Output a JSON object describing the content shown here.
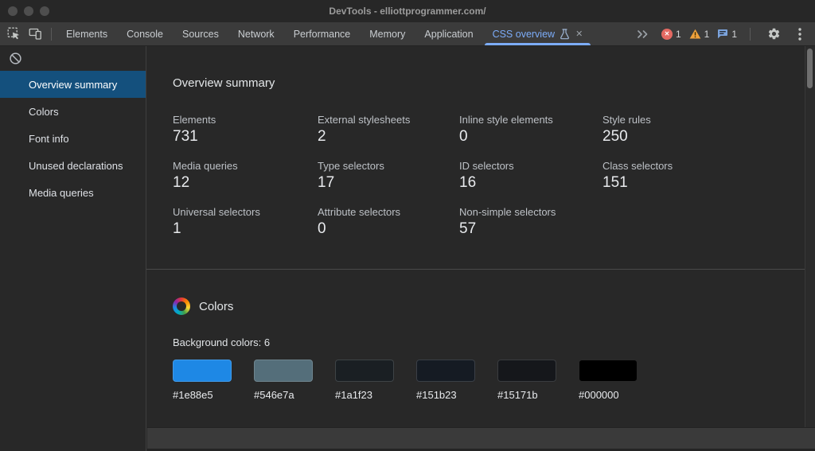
{
  "window": {
    "title": "DevTools - elliottprogrammer.com/"
  },
  "toolbar": {
    "tabs": [
      {
        "label": "Elements"
      },
      {
        "label": "Console"
      },
      {
        "label": "Sources"
      },
      {
        "label": "Network"
      },
      {
        "label": "Performance"
      },
      {
        "label": "Memory"
      },
      {
        "label": "Application"
      },
      {
        "label": "CSS overview",
        "selected": true
      }
    ],
    "badges": {
      "errors": "1",
      "warnings": "1",
      "issues": "1"
    }
  },
  "sidebar": {
    "items": [
      {
        "label": "Overview summary",
        "selected": true
      },
      {
        "label": "Colors"
      },
      {
        "label": "Font info"
      },
      {
        "label": "Unused declarations"
      },
      {
        "label": "Media queries"
      }
    ]
  },
  "main": {
    "summary": {
      "title": "Overview summary",
      "stats": [
        {
          "label": "Elements",
          "value": "731"
        },
        {
          "label": "External stylesheets",
          "value": "2"
        },
        {
          "label": "Inline style elements",
          "value": "0"
        },
        {
          "label": "Style rules",
          "value": "250"
        },
        {
          "label": "Media queries",
          "value": "12"
        },
        {
          "label": "Type selectors",
          "value": "17"
        },
        {
          "label": "ID selectors",
          "value": "16"
        },
        {
          "label": "Class selectors",
          "value": "151"
        },
        {
          "label": "Universal selectors",
          "value": "1"
        },
        {
          "label": "Attribute selectors",
          "value": "0"
        },
        {
          "label": "Non-simple selectors",
          "value": "57"
        }
      ]
    },
    "colors": {
      "title": "Colors",
      "background_label": "Background colors: 6",
      "swatches": [
        {
          "hex": "#1e88e5"
        },
        {
          "hex": "#546e7a"
        },
        {
          "hex": "#1a1f23"
        },
        {
          "hex": "#151b23"
        },
        {
          "hex": "#15171b"
        },
        {
          "hex": "#000000"
        }
      ]
    }
  },
  "theme": {
    "accent": "#7cacf8",
    "selection": "#14507d",
    "error": "#e46962",
    "warning": "#f0a13c",
    "issues": "#7ba3dc"
  }
}
